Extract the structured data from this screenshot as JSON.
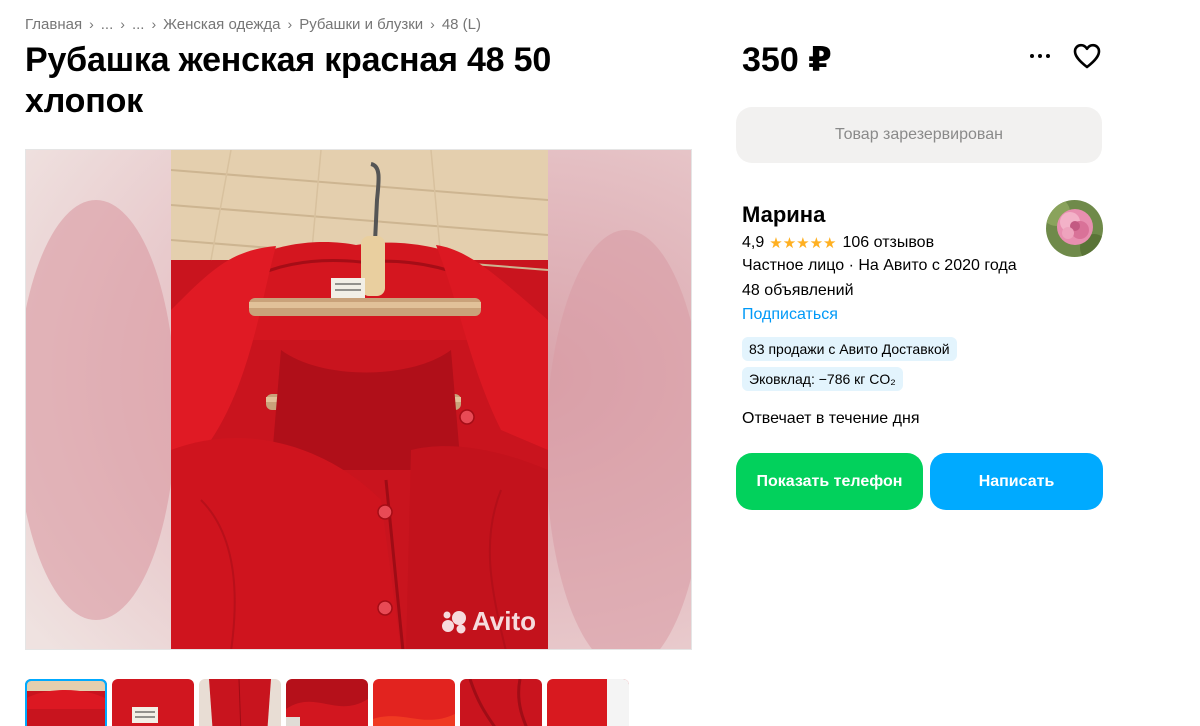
{
  "breadcrumb": {
    "items": [
      "Главная",
      "...",
      "...",
      "Женская одежда",
      "Рубашки и блузки",
      "48 (L)"
    ],
    "separator": "›"
  },
  "listing": {
    "title": "Рубашка женская красная 48 50 хлопок",
    "price": "350 ₽",
    "status_button": "Товар зарезервирован"
  },
  "gallery": {
    "watermark": "Avito",
    "thumbnail_count": 7
  },
  "seller": {
    "name": "Марина",
    "rating": "4,9",
    "stars": "★★★★★",
    "reviews": "106 отзывов",
    "type_since": "Частное лицо · На Авито с 2020 года",
    "listings": "48 объявлений",
    "subscribe": "Подписаться",
    "badges": [
      "83 продажи с Авито Доставкой",
      "Эковклад: −786 кг CO₂"
    ],
    "response_time": "Отвечает в течение дня"
  },
  "actions": {
    "show_phone": "Показать телефон",
    "write": "Написать"
  },
  "icons": {
    "more": "more-dots-icon",
    "favorite": "heart-icon"
  },
  "colors": {
    "green_button": "#02d15c",
    "blue_button": "#00aaff",
    "link": "#0099f7",
    "star": "#ffb021",
    "badge_bg": "#e3f4fd",
    "shirt_red": "#d0141f"
  }
}
